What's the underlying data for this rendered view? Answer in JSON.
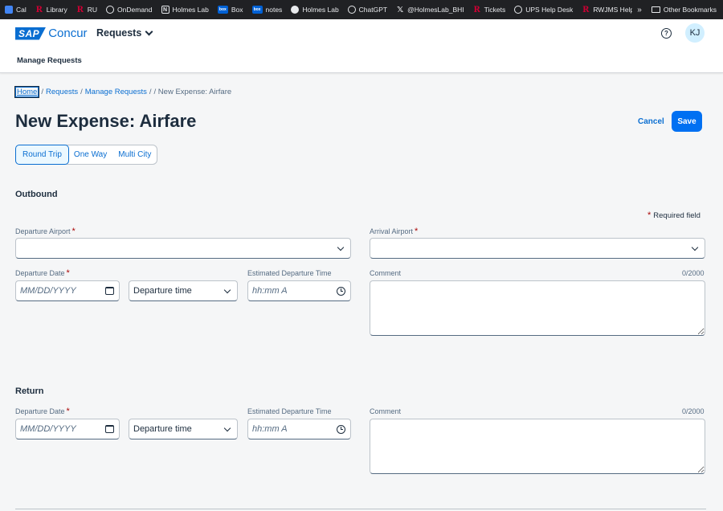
{
  "bookmarks": [
    {
      "label": "Cal",
      "icon": "calendar-icon"
    },
    {
      "label": "Library",
      "icon": "rutgers-r-icon"
    },
    {
      "label": "RU",
      "icon": "rutgers-r-icon"
    },
    {
      "label": "OnDemand",
      "icon": "globe-icon"
    },
    {
      "label": "Holmes Lab",
      "icon": "notion-icon"
    },
    {
      "label": "Box",
      "icon": "box-icon"
    },
    {
      "label": "notes",
      "icon": "box-icon"
    },
    {
      "label": "Holmes Lab",
      "icon": "github-icon"
    },
    {
      "label": "ChatGPT",
      "icon": "chatgpt-icon"
    },
    {
      "label": "@HolmesLab_BHI",
      "icon": "x-icon"
    },
    {
      "label": "Tickets",
      "icon": "rutgers-r-icon"
    },
    {
      "label": "UPS Help Desk",
      "icon": "globe-icon"
    },
    {
      "label": "RWJMS Help Desk",
      "icon": "rutgers-r-icon"
    }
  ],
  "bookmarks_other": "Other Bookmarks",
  "header": {
    "brand_sap": "SAP",
    "brand_concur": "Concur",
    "nav_menu": "Requests",
    "help_glyph": "?",
    "avatar_initials": "KJ",
    "subnav": "Manage Requests"
  },
  "breadcrumb": {
    "home": "Home",
    "requests": "Requests",
    "manage": "Manage Requests",
    "current": "/ New Expense: Airfare"
  },
  "page": {
    "title": "New Expense: Airfare",
    "cancel_label": "Cancel",
    "save_label": "Save"
  },
  "trip_types": [
    "Round Trip",
    "One Way",
    "Multi City"
  ],
  "trip_type_selected": "Round Trip",
  "required_note": "Required field",
  "outbound": {
    "title": "Outbound",
    "departure_airport_label": "Departure Airport",
    "arrival_airport_label": "Arrival Airport",
    "departure_date_label": "Departure Date",
    "departure_date_placeholder": "MM/DD/YYYY",
    "departure_time_value": "Departure time",
    "est_time_label": "Estimated Departure Time",
    "est_time_placeholder": "hh:mm A",
    "comment_label": "Comment",
    "comment_counter": "0/2000"
  },
  "return": {
    "title": "Return",
    "departure_date_label": "Departure Date",
    "departure_date_placeholder": "MM/DD/YYYY",
    "departure_time_value": "Departure time",
    "est_time_label": "Estimated Departure Time",
    "est_time_placeholder": "hh:mm A",
    "comment_label": "Comment",
    "comment_counter": "0/2000"
  },
  "colors": {
    "accent": "#0a6ed1",
    "save_button": "#0070f2",
    "required": "#aa0808",
    "text": "#1d2d3e"
  }
}
